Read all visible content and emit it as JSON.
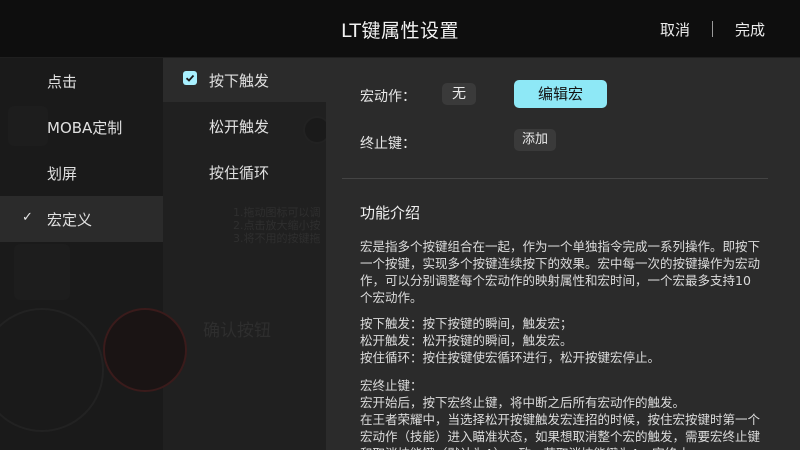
{
  "header": {
    "title": "LT键属性设置",
    "cancel_label": "取消",
    "done_label": "完成"
  },
  "left_menu": {
    "items": [
      {
        "label": "点击"
      },
      {
        "label": "MOBA定制"
      },
      {
        "label": "划屏"
      },
      {
        "label": "宏定义"
      }
    ],
    "active_check": "✓"
  },
  "trigger_menu": {
    "items": [
      {
        "label": "按下触发"
      },
      {
        "label": "松开触发"
      },
      {
        "label": "按住循环"
      }
    ]
  },
  "macro": {
    "action_label": "宏动作：",
    "none_label": "无",
    "edit_label": "编辑宏",
    "stop_key_label": "终止键：",
    "add_label": "添加"
  },
  "intro": {
    "title": "功能介绍",
    "para1": "宏是指多个按键组合在一起，作为一个单独指令完成一系列操作。即按下一个按键，实现多个按键连续按下的效果。宏中每一次的按键操作为宏动作，可以分别调整每个宏动作的映射属性和宏时间，一个宏最多支持10个宏动作。",
    "mode_lines": [
      "按下触发：按下按键的瞬间，触发宏；",
      "松开触发：松开按键的瞬间，触发宏。",
      "按住循环：按住按键使宏循环进行，松开按键宏停止。"
    ],
    "stop_title": "宏终止键：",
    "stop_lines": [
      "宏开始后，按下宏终止键，将中断之后所有宏动作的触发。",
      "在王者荣耀中，当选择松开按键触发宏连招的时候，按住宏按键时第一个宏动作（技能）进入瞄准状态，如果想取消整个宏的触发，需要宏终止键和取消技能键（默认为A）一致，若取消技能键为A，宏终止"
    ]
  },
  "background_hint": {
    "lines": [
      "1.拖动图标可以调",
      "2.点击放大缩小按",
      "3.将不用的按键拖"
    ],
    "big_text": "确认按钮"
  },
  "colors": {
    "accent": "#8ee8f6",
    "panel": "#2b2b2b"
  }
}
